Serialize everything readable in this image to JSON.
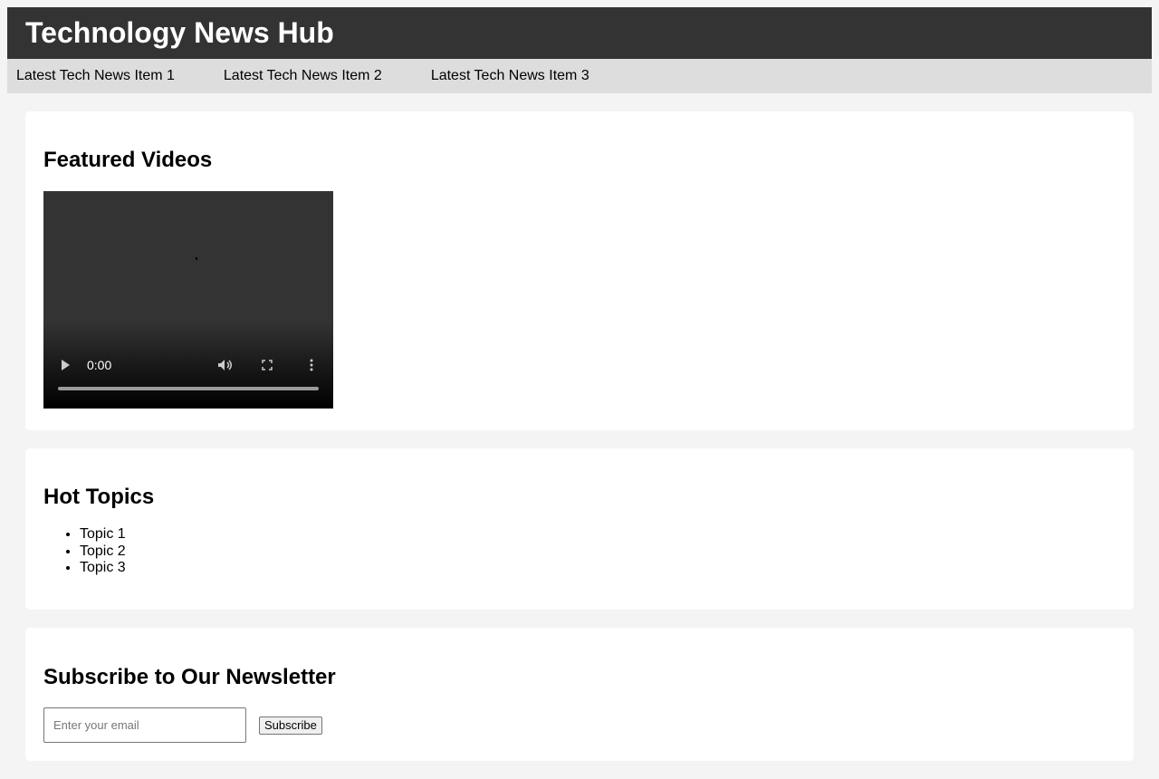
{
  "header": {
    "title": "Technology News Hub"
  },
  "ticker": {
    "items": [
      "Latest Tech News Item 1",
      "Latest Tech News Item 2",
      "Latest Tech News Item 3"
    ]
  },
  "videos": {
    "heading": "Featured Videos",
    "player": {
      "time": "0:00",
      "progress": 0,
      "icons": [
        "play-icon",
        "volume-icon",
        "fullscreen-icon",
        "more-options-icon"
      ]
    }
  },
  "topics": {
    "heading": "Hot Topics",
    "items": [
      "Topic 1",
      "Topic 2",
      "Topic 3"
    ]
  },
  "newsletter": {
    "heading": "Subscribe to Our Newsletter",
    "email_placeholder": "Enter your email",
    "email_value": "",
    "button_label": "Subscribe"
  },
  "colors": {
    "header_bg": "#333333",
    "ticker_bg": "#dddddd",
    "page_bg": "#f4f4f4",
    "card_bg": "#ffffff"
  }
}
